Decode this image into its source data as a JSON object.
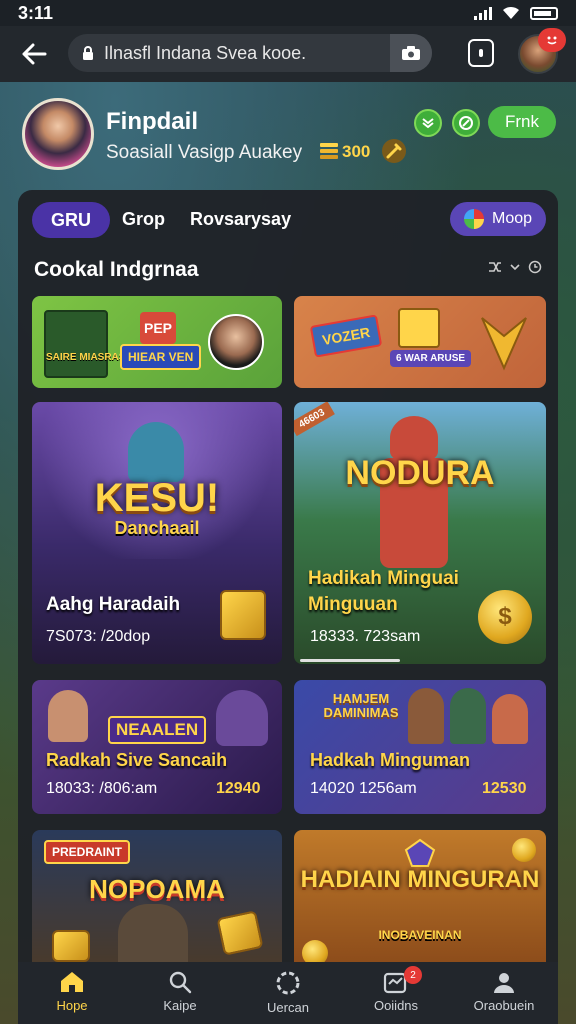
{
  "status": {
    "time": "3:11"
  },
  "browser": {
    "url": "Ilnasfl Indana Svea kooe."
  },
  "profile": {
    "name": "Finpdail",
    "subtitle": "Soasiall Vasigp Auakey",
    "coins": "300",
    "action_label": "Frnk"
  },
  "tabs": {
    "active": "GRU",
    "items": [
      "Grop",
      "Rovsarysay"
    ],
    "moop_label": "Moop"
  },
  "section": {
    "title": "Cookal Indgrnaa"
  },
  "promos": [
    {
      "art_1": "PEP",
      "art_2": "HIEAR VEN",
      "art_3": "SAIRE MIASRAS"
    },
    {
      "art_1": "VOZER",
      "art_2": "6 WAR ARUSE"
    }
  ],
  "cards": [
    {
      "title": "KESU!",
      "subtitle": "Danchaail",
      "name": "Aahg Haradaih",
      "meta": "7S073: /20dop"
    },
    {
      "corner": "46603",
      "title": "NODURA",
      "name": "Hadikah Minguai Minguuan",
      "meta": "18333. 723sam"
    },
    {
      "title": "NEAALEN",
      "name": "Radkah Sive Sancaih",
      "meta": "18033: /806:am",
      "score": "12940"
    },
    {
      "title": "HAMJEM DAMINIMAS",
      "name": "Hadkah Minguman",
      "meta": "14020 1256am",
      "score": "12530"
    },
    {
      "badge": "PREDRAINT",
      "title": "NOPOAMA"
    },
    {
      "title": "HADIAIN MINGURAN",
      "subtitle": "INOBAVEINAN"
    }
  ],
  "nav": [
    {
      "label": "Hope",
      "icon": "home-icon"
    },
    {
      "label": "Kaipe",
      "icon": "search-icon"
    },
    {
      "label": "Uercan",
      "icon": "loading-icon"
    },
    {
      "label": "Ooiidns",
      "icon": "inbox-icon",
      "badge": "2"
    },
    {
      "label": "Oraobuein",
      "icon": "profile-icon"
    }
  ],
  "colors": {
    "accent": "#4a33a6",
    "green": "#4cbb47",
    "gold": "#ffd54a",
    "badge": "#e53935"
  }
}
